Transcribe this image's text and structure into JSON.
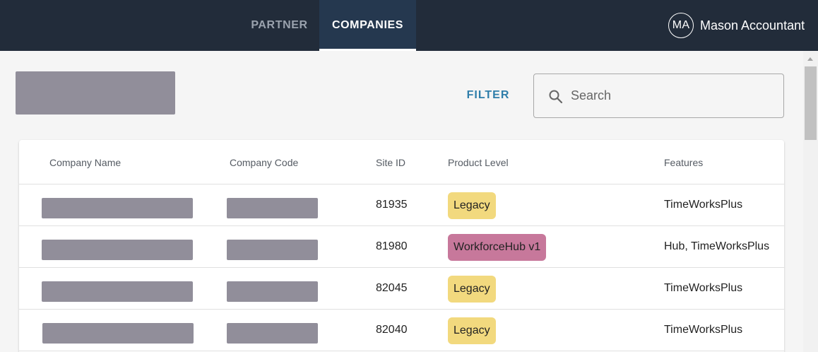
{
  "header": {
    "tabs": [
      {
        "label": "PARTNER",
        "active": false
      },
      {
        "label": "COMPANIES",
        "active": true
      }
    ],
    "user": {
      "initials": "MA",
      "name": "Mason Accountant"
    }
  },
  "toolbar": {
    "filter_label": "FILTER",
    "search_placeholder": "Search",
    "search_value": ""
  },
  "table": {
    "columns": [
      "Company Name",
      "Company Code",
      "Site ID",
      "Product Level",
      "Features"
    ],
    "rows": [
      {
        "site_id": "81935",
        "product_level": "Legacy",
        "features": "TimeWorksPlus"
      },
      {
        "site_id": "81980",
        "product_level": "WorkforceHub v1",
        "features": "Hub, TimeWorksPlus"
      },
      {
        "site_id": "82045",
        "product_level": "Legacy",
        "features": "TimeWorksPlus"
      },
      {
        "site_id": "82040",
        "product_level": "Legacy",
        "features": "TimeWorksPlus"
      }
    ]
  },
  "colors": {
    "topbar": "#222c3a",
    "active_tab": "#25384f",
    "accent": "#2f7eaa",
    "legacy_chip": "#f2d97e",
    "workforcehub_chip": "#c7789b",
    "redaction": "#918e9a"
  },
  "icons": {
    "search": "search-icon"
  }
}
